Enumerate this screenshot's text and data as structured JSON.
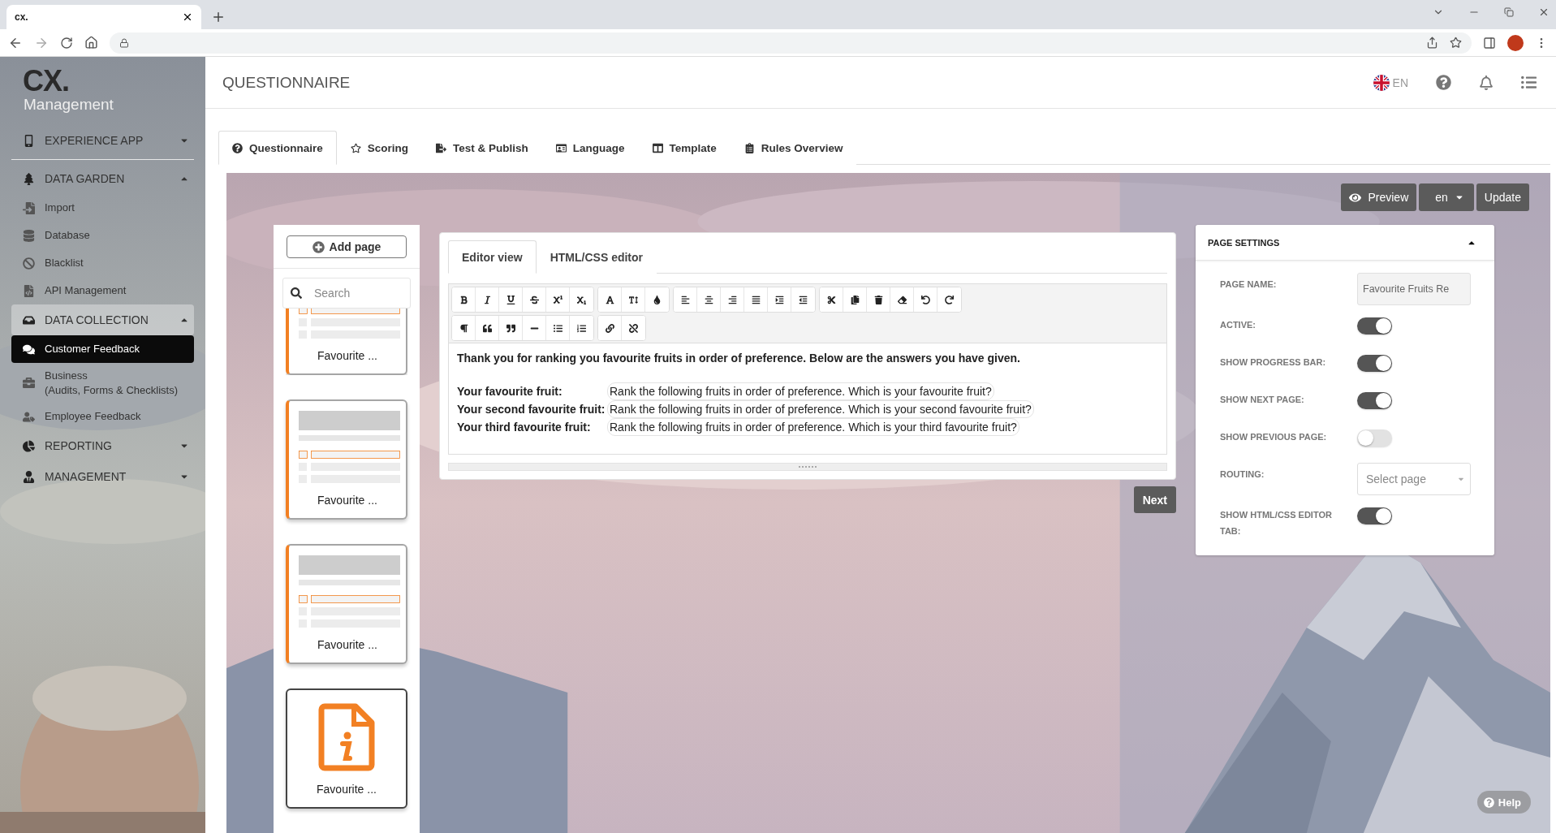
{
  "browser": {
    "tab_title": "cx."
  },
  "sidebar": {
    "logo": "CX.",
    "subtitle": "Management",
    "items": [
      {
        "kind": "section",
        "label": "EXPERIENCE APP",
        "expanded": false,
        "selected": false
      },
      {
        "kind": "section",
        "label": "DATA GARDEN",
        "expanded": true,
        "selected": false
      },
      {
        "kind": "link",
        "label": "Import",
        "selected": false
      },
      {
        "kind": "link",
        "label": "Database",
        "selected": false
      },
      {
        "kind": "link",
        "label": "Blacklist",
        "selected": false
      },
      {
        "kind": "link",
        "label": "API Management",
        "selected": false
      },
      {
        "kind": "section",
        "label": "DATA COLLECTION",
        "expanded": true,
        "selected": true
      },
      {
        "kind": "link",
        "label": "Customer Feedback",
        "selected": true
      },
      {
        "kind": "link",
        "label": "Business\n(Audits, Forms & Checklists)",
        "selected": false
      },
      {
        "kind": "link",
        "label": "Employee Feedback",
        "selected": false
      },
      {
        "kind": "section",
        "label": "REPORTING",
        "expanded": false,
        "selected": false
      },
      {
        "kind": "section",
        "label": "MANAGEMENT",
        "expanded": false,
        "selected": false
      }
    ]
  },
  "header": {
    "title": "QUESTIONNAIRE",
    "language": "EN"
  },
  "tabs": [
    {
      "label": "Questionnaire",
      "selected": true
    },
    {
      "label": "Scoring",
      "selected": false
    },
    {
      "label": "Test & Publish",
      "selected": false
    },
    {
      "label": "Language",
      "selected": false
    },
    {
      "label": "Template",
      "selected": false
    },
    {
      "label": "Rules Overview",
      "selected": false
    }
  ],
  "actions": {
    "preview": "Preview",
    "language": "en",
    "update": "Update"
  },
  "pages_panel": {
    "add_page": "Add page",
    "search": {
      "placeholder": "Search"
    },
    "pages": [
      {
        "kind": "question",
        "label": "Favourite ...",
        "selected": false
      },
      {
        "kind": "question",
        "label": "Favourite ...",
        "selected": false
      },
      {
        "kind": "question",
        "label": "Favourite ...",
        "selected": false
      },
      {
        "kind": "info",
        "label": "Favourite ...",
        "selected": true
      }
    ]
  },
  "editor": {
    "tabs": [
      {
        "label": "Editor view",
        "selected": true
      },
      {
        "label": "HTML/CSS editor",
        "selected": false
      }
    ],
    "intro": "Thank you for ranking you favourite fruits in order of preference. Below are the answers you have given.",
    "answers": [
      {
        "label": "Your favourite fruit:",
        "value": "Rank the following fruits in order of preference. Which is your favourite fruit?"
      },
      {
        "label": "Your second favourite fruit:",
        "value": "Rank the following fruits in order of preference. Which is your second favourite fruit?"
      },
      {
        "label": "Your third favourite fruit:",
        "value": "Rank the following fruits in order of preference. Which is your third favourite fruit?"
      }
    ],
    "next": "Next"
  },
  "settings": {
    "title": "PAGE SETTINGS",
    "expanded": true,
    "fields": [
      {
        "kind": "text",
        "label": "PAGE NAME:",
        "value": "Favourite Fruits Re"
      },
      {
        "kind": "toggle",
        "label": "ACTIVE:",
        "on": true
      },
      {
        "kind": "toggle",
        "label": "SHOW PROGRESS BAR:",
        "on": true
      },
      {
        "kind": "toggle",
        "label": "SHOW NEXT PAGE:",
        "on": true
      },
      {
        "kind": "toggle",
        "label": "SHOW PREVIOUS PAGE:",
        "on": false
      },
      {
        "kind": "select",
        "label": "ROUTING:",
        "placeholder": "Select page"
      },
      {
        "kind": "toggle",
        "label": "SHOW HTML/CSS EDITOR TAB:",
        "on": true
      }
    ]
  },
  "help": "Help"
}
